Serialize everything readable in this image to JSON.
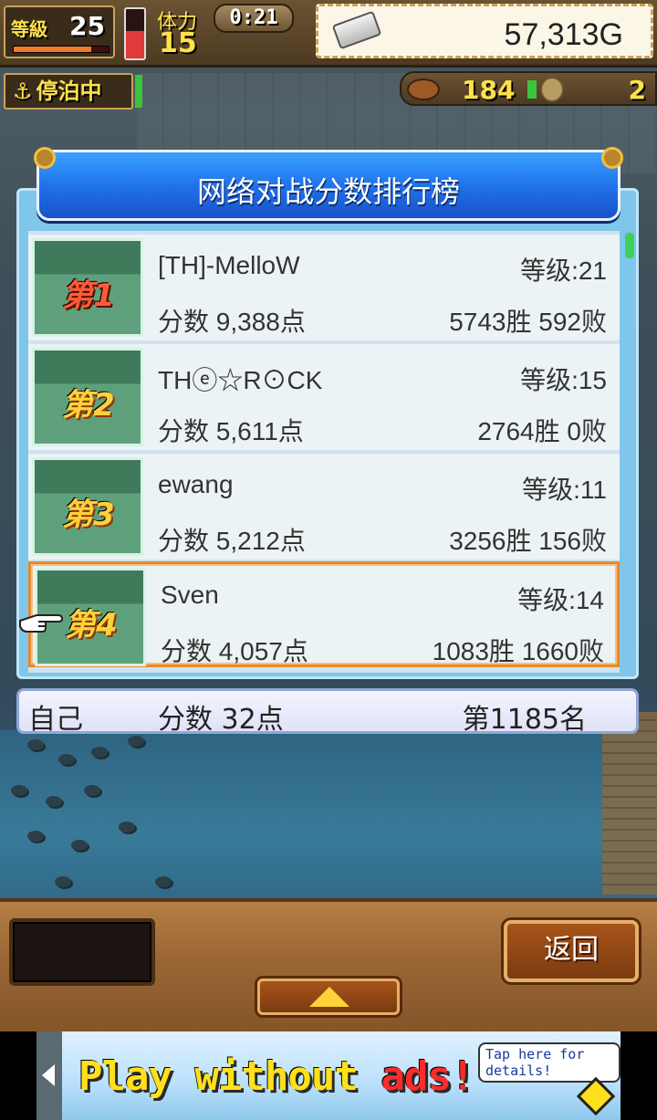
{
  "hud": {
    "level_label": "等級",
    "level_value": "25",
    "level_progress": 0.82,
    "energy_level": 0.55,
    "stamina_label": "体力",
    "stamina_value": "15",
    "timer": "0:21",
    "gold": "57,313G"
  },
  "status": {
    "docked_label": "停泊中",
    "food_value": "184",
    "medal_value": "2"
  },
  "leaderboard": {
    "title": "网络对战分数排行榜",
    "entries": [
      {
        "rank_badge": "第1",
        "name": "[TH]-MelloW",
        "level": "等级:21",
        "score": "分数 9,388点",
        "record": "5743胜 592败"
      },
      {
        "rank_badge": "第2",
        "name": "THⓔ☆R⊙CK",
        "level": "等级:15",
        "score": "分数 5,611点",
        "record": "2764胜 0败"
      },
      {
        "rank_badge": "第3",
        "name": "ewang",
        "level": "等级:11",
        "score": "分数 5,212点",
        "record": "3256胜 156败"
      },
      {
        "rank_badge": "第4",
        "name": "Sven",
        "level": "等级:14",
        "score": "分数 4,057点",
        "record": "1083胜 1660败"
      }
    ]
  },
  "self_row": {
    "label": "自己",
    "score": "分数 32点",
    "rank": "第1185名"
  },
  "bottom_bar": {
    "back_label": "返回"
  },
  "ad": {
    "headline_main": "Play without ",
    "headline_accent": "ads!",
    "tap_text": "Tap here for details!"
  },
  "colors": {
    "title_blue": "#1f6fe8",
    "highlight_orange": "#e8892a",
    "gold_text": "#ffd23a"
  },
  "icons": [
    "ingot-icon",
    "anchor-icon",
    "food-icon",
    "coin-icon",
    "hand-pointer-icon",
    "up-arrow-icon",
    "ad-left-arrow-icon"
  ]
}
